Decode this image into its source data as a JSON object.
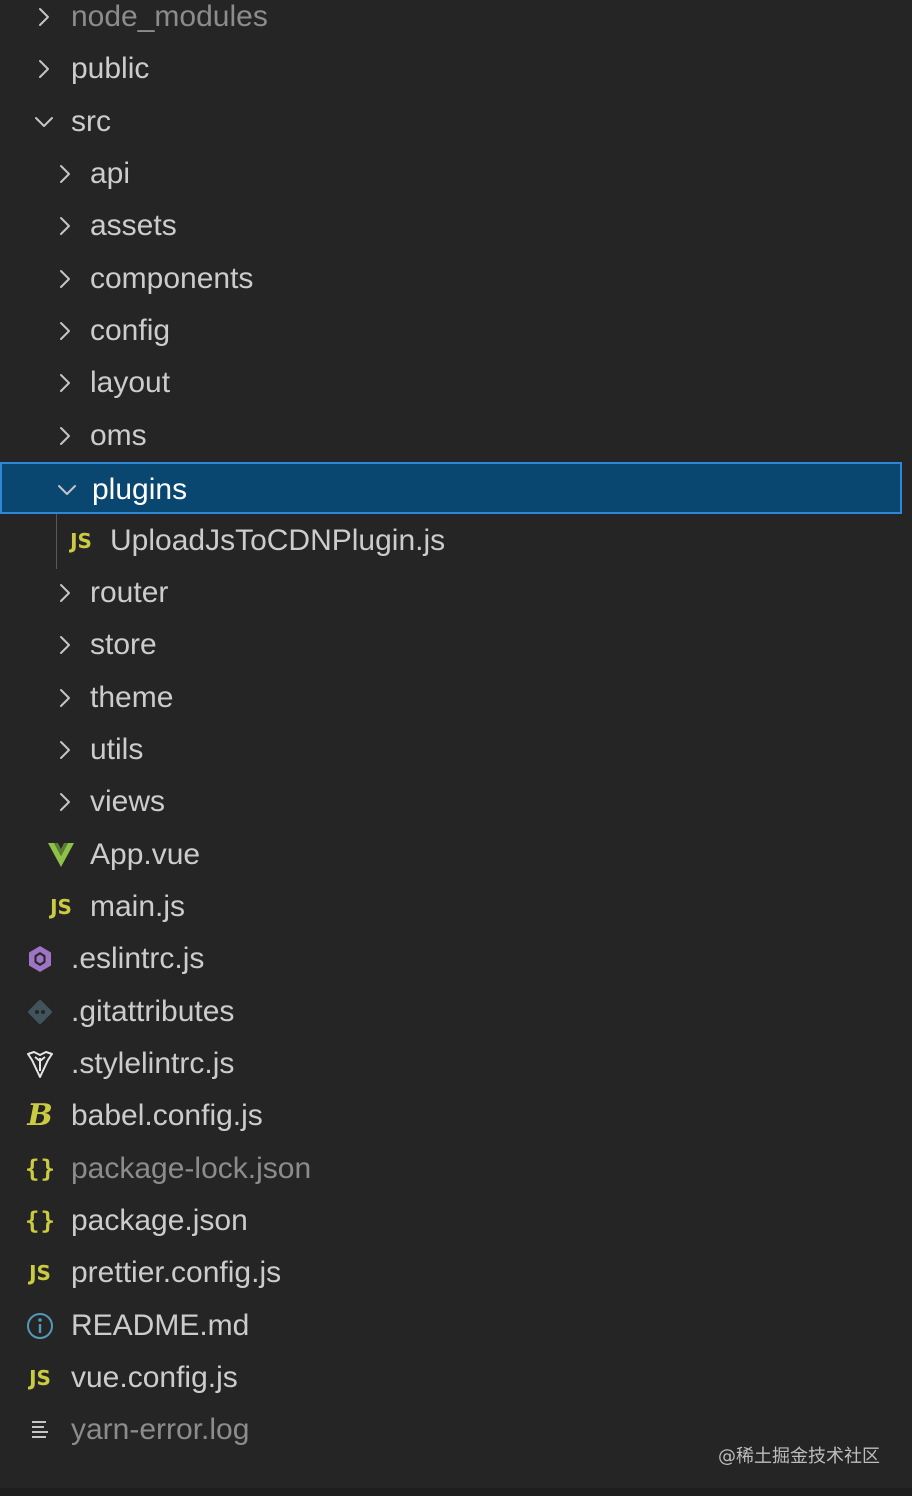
{
  "explorer": {
    "items": [
      {
        "label": "node_modules",
        "kind": "folder",
        "expanded": false,
        "depth": 0,
        "dim": true
      },
      {
        "label": "public",
        "kind": "folder",
        "expanded": false,
        "depth": 0
      },
      {
        "label": "src",
        "kind": "folder",
        "expanded": true,
        "depth": 0
      },
      {
        "label": "api",
        "kind": "folder",
        "expanded": false,
        "depth": 1
      },
      {
        "label": "assets",
        "kind": "folder",
        "expanded": false,
        "depth": 1
      },
      {
        "label": "components",
        "kind": "folder",
        "expanded": false,
        "depth": 1
      },
      {
        "label": "config",
        "kind": "folder",
        "expanded": false,
        "depth": 1
      },
      {
        "label": "layout",
        "kind": "folder",
        "expanded": false,
        "depth": 1
      },
      {
        "label": "oms",
        "kind": "folder",
        "expanded": false,
        "depth": 1
      },
      {
        "label": "plugins",
        "kind": "folder",
        "expanded": true,
        "depth": 1,
        "selected": true
      },
      {
        "label": "UploadJsToCDNPlugin.js",
        "kind": "file",
        "icon": "js-file-icon",
        "icon_text": "JS",
        "depth": 2
      },
      {
        "label": "router",
        "kind": "folder",
        "expanded": false,
        "depth": 1
      },
      {
        "label": "store",
        "kind": "folder",
        "expanded": false,
        "depth": 1
      },
      {
        "label": "theme",
        "kind": "folder",
        "expanded": false,
        "depth": 1
      },
      {
        "label": "utils",
        "kind": "folder",
        "expanded": false,
        "depth": 1
      },
      {
        "label": "views",
        "kind": "folder",
        "expanded": false,
        "depth": 1
      },
      {
        "label": "App.vue",
        "kind": "file",
        "icon": "vue-file-icon",
        "depth": 1
      },
      {
        "label": "main.js",
        "kind": "file",
        "icon": "js-file-icon",
        "icon_text": "JS",
        "depth": 1
      },
      {
        "label": ".eslintrc.js",
        "kind": "file",
        "icon": "eslint-file-icon",
        "depth": 0
      },
      {
        "label": ".gitattributes",
        "kind": "file",
        "icon": "git-file-icon",
        "depth": 0
      },
      {
        "label": ".stylelintrc.js",
        "kind": "file",
        "icon": "stylelint-file-icon",
        "depth": 0
      },
      {
        "label": "babel.config.js",
        "kind": "file",
        "icon": "babel-file-icon",
        "icon_text": "B",
        "depth": 0
      },
      {
        "label": "package-lock.json",
        "kind": "file",
        "icon": "json-file-icon",
        "icon_text": "{}",
        "depth": 0,
        "dim": true
      },
      {
        "label": "package.json",
        "kind": "file",
        "icon": "json-file-icon",
        "icon_text": "{}",
        "depth": 0
      },
      {
        "label": "prettier.config.js",
        "kind": "file",
        "icon": "js-file-icon",
        "icon_text": "JS",
        "depth": 0
      },
      {
        "label": "README.md",
        "kind": "file",
        "icon": "info-file-icon",
        "depth": 0
      },
      {
        "label": "vue.config.js",
        "kind": "file",
        "icon": "js-file-icon",
        "icon_text": "JS",
        "depth": 0
      },
      {
        "label": "yarn-error.log",
        "kind": "file",
        "icon": "log-file-icon",
        "depth": 0,
        "dim": true
      }
    ]
  },
  "watermark": "@稀土掘金技术社区",
  "colors": {
    "background": "#252526",
    "selection": "#094771",
    "selection_border": "#2f86d6",
    "text": "#cccccc",
    "dim_text": "#8c8c8c",
    "js_yellow": "#cbcb41",
    "vue_green": "#8dc149",
    "eslint_purple": "#a074c4",
    "info_blue": "#519aba"
  }
}
